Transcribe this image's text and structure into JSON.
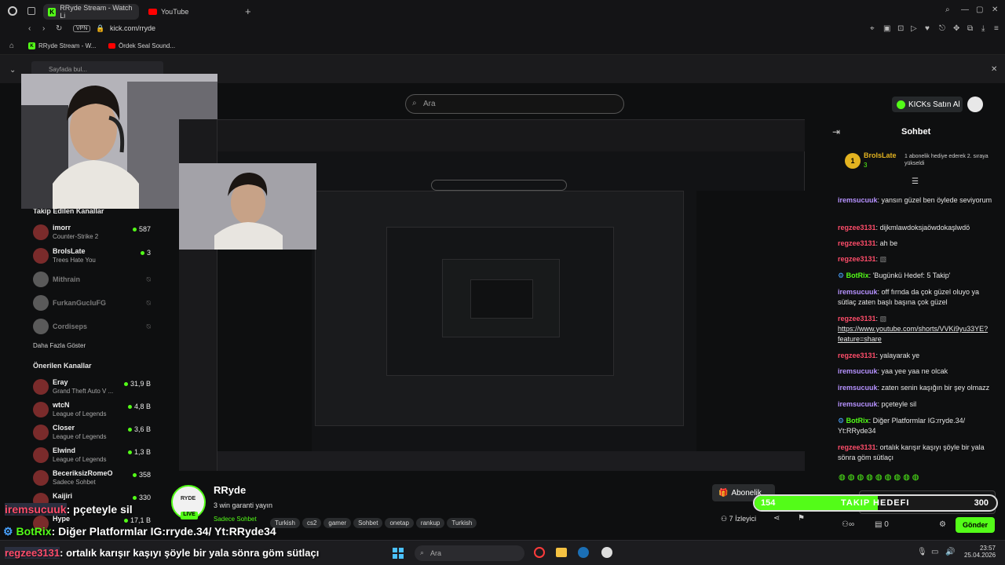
{
  "browser": {
    "tabs": [
      {
        "label": "RRyde Stream - Watch Li",
        "active": true
      },
      {
        "label": "YouTube",
        "active": false
      }
    ],
    "url": "kick.com/rryde",
    "vpn": "VPN",
    "bookmarks": [
      {
        "label": "RRyde Stream - W..."
      },
      {
        "label": "Ördek Seal Sound..."
      }
    ],
    "find_placeholder": "Sayfada bul..."
  },
  "header": {
    "search_placeholder": "Ara",
    "buy_kicks": "KICKs Satın Al"
  },
  "sidebar": {
    "followed_title": "Takip Edilen Kanallar",
    "followed": [
      {
        "name": "imorr",
        "game": "Counter-Strike 2",
        "viewers": "587",
        "online": true
      },
      {
        "name": "BroIsLate",
        "game": "Trees Hate You",
        "viewers": "3",
        "online": true
      },
      {
        "name": "Mithrain",
        "online": false
      },
      {
        "name": "FurkanGucluFG",
        "online": false
      },
      {
        "name": "Cordiseps",
        "online": false
      }
    ],
    "show_more": "Daha Fazla Göster",
    "recommended_title": "Önerilen Kanallar",
    "recommended": [
      {
        "name": "Eray",
        "game": "Grand Theft Auto V ...",
        "viewers": "31,9 B"
      },
      {
        "name": "wtcN",
        "game": "League of Legends",
        "viewers": "4,8 B"
      },
      {
        "name": "Closer",
        "game": "League of Legends",
        "viewers": "3,6 B"
      },
      {
        "name": "Elwind",
        "game": "League of Legends",
        "viewers": "1,3 B"
      },
      {
        "name": "BeceriksizRomeO",
        "game": "Sadece Sohbet",
        "viewers": "358"
      },
      {
        "name": "Kaijiri",
        "game": "",
        "viewers": "330"
      },
      {
        "name": "Hype",
        "game": "",
        "viewers": "17,1 B"
      }
    ]
  },
  "stream": {
    "streamer": "RRyde",
    "title": "3 win garanti yayın",
    "category": "Sadece Sohbet",
    "tags": [
      "Turkish",
      "cs2",
      "gamer",
      "Sohbet",
      "onetap",
      "rankup",
      "Turkish"
    ],
    "live_label": "LIVE",
    "logo_text": "RYDE",
    "subscribe": "Abonelik",
    "viewers": "7 İzleyici"
  },
  "chat": {
    "title": "Sohbet",
    "pinned_user": "BroIsLate",
    "pinned_count": "3",
    "pinned_text": "1 abonelik hediye ederek 2. sıraya yükseldi",
    "messages": [
      {
        "user": "iremsucuuk",
        "color": "purple",
        "text": "yansın güzel ben öylede seviyorum"
      },
      {
        "user": "regzee3131",
        "color": "red",
        "text": "dijkmlawdoksjaöwdokaşlwdö"
      },
      {
        "user": "regzee3131",
        "color": "red",
        "text": "ah be"
      },
      {
        "user": "regzee3131",
        "color": "red",
        "text": ""
      },
      {
        "user": "BotRix",
        "color": "green",
        "text": "'Bugünkü Hedef: 5 Takip'"
      },
      {
        "user": "iremsucuuk",
        "color": "purple",
        "text": "off fırnda da çok güzel oluyo ya sütlaç zaten başlı başına çok güzel"
      },
      {
        "user": "regzee3131",
        "color": "red",
        "text": ""
      },
      {
        "user": "",
        "color": "link",
        "text": "https://www.youtube.com/shorts/VVKi9yu33YE?feature=share"
      },
      {
        "user": "regzee3131",
        "color": "red",
        "text": "yalayarak ye"
      },
      {
        "user": "iremsucuuk",
        "color": "purple",
        "text": "yaa yee yaa ne olcak"
      },
      {
        "user": "iremsucuuk",
        "color": "purple",
        "text": "zaten senin kaşığın bir şey olmazz"
      },
      {
        "user": "iremsucuuk",
        "color": "purple",
        "text": "pçeteyle sil"
      },
      {
        "user": "BotRix",
        "color": "green",
        "text": "Diğer Platformlar IG:rryde.34/ Yt:RRyde34"
      },
      {
        "user": "regzee3131",
        "color": "red",
        "text": "ortalık karışır kaşıyı şöyle bir yala sönra göm sütlaçı"
      }
    ],
    "kicks_count": "0",
    "send_label": "Gönder"
  },
  "goal": {
    "count": "154",
    "label": "TAKIP HEDEFI",
    "target": "300",
    "progress": 0.51
  },
  "overlay": {
    "lines": [
      {
        "user": "iremsucuuk",
        "text": ": pçeteyle sil"
      },
      {
        "user": "BotRix",
        "text": ": Diğer Platformlar IG:rryde.34/ Yt:RRyde34"
      },
      {
        "user": "regzee3131",
        "text": ": ortalık karışır kaşıyı şöyle bir yala sönra göm sütlaçı"
      }
    ]
  },
  "taskbar": {
    "search": "Ara",
    "time": "23:57",
    "date": "25.04.2026"
  }
}
